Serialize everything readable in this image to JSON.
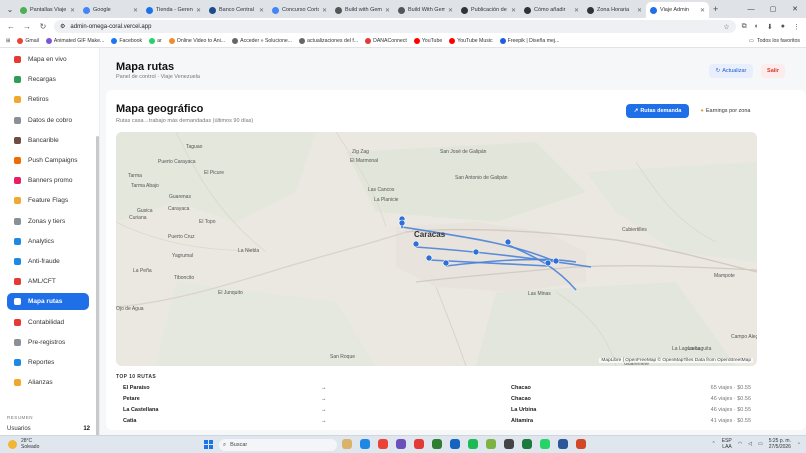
{
  "browser": {
    "tabs": [
      {
        "label": "Pantallas Viaje",
        "color": "#4caf50",
        "active": false
      },
      {
        "label": "Google",
        "color": "#4285f4",
        "active": false
      },
      {
        "label": "Tienda - Gerencia",
        "color": "#1a73e8",
        "active": false
      },
      {
        "label": "Banco Central",
        "color": "#1c4b8c",
        "active": false
      },
      {
        "label": "Concurso Corto",
        "color": "#4285f4",
        "active": false
      },
      {
        "label": "Build with Gemini",
        "color": "#555555",
        "active": false
      },
      {
        "label": "Build With Gemini",
        "color": "#555555",
        "active": false
      },
      {
        "label": "Publicación de",
        "color": "#333333",
        "active": false
      },
      {
        "label": "Cómo añadir",
        "color": "#333333",
        "active": false
      },
      {
        "label": "Zona Horaria",
        "color": "#333333",
        "active": false
      },
      {
        "label": "Viaje Admin",
        "color": "#1f6fe8",
        "active": true
      }
    ],
    "url": "admin-omega-coral.vercel.app",
    "bookmarks": [
      {
        "label": "Gmail",
        "color": "#ea4335"
      },
      {
        "label": "Animated GIF Make...",
        "color": "#7b57d6"
      },
      {
        "label": "Facebook",
        "color": "#1877f2"
      },
      {
        "label": "ar",
        "color": "#25d366"
      },
      {
        "label": "Online Video to Ani...",
        "color": "#f28b30"
      },
      {
        "label": "Acceder » Solucione...",
        "color": "#666666"
      },
      {
        "label": "actualizaciones del f...",
        "color": "#666666"
      },
      {
        "label": "DANAConnect",
        "color": "#e53935"
      },
      {
        "label": "YouTube",
        "color": "#ff0000"
      },
      {
        "label": "YouTube Music",
        "color": "#ff0000"
      },
      {
        "label": "Freepik | Diseña mej...",
        "color": "#1e5be6"
      }
    ],
    "all_bookmarks": "Todos los favoritos"
  },
  "sidebar": {
    "items": [
      {
        "label": "Mapa en vivo",
        "color": "#e53935"
      },
      {
        "label": "Recargas",
        "color": "#2e9e56"
      },
      {
        "label": "Retiros",
        "color": "#f0a830"
      },
      {
        "label": "Datos de cobro",
        "color": "#8a8f98"
      },
      {
        "label": "Bancarible",
        "color": "#6d4c41"
      },
      {
        "label": "Push Campaigns",
        "color": "#ef6c00"
      },
      {
        "label": "Banners promo",
        "color": "#e91e63"
      },
      {
        "label": "Feature Flags",
        "color": "#f0a830"
      },
      {
        "label": "Zonas y tiers",
        "color": "#8a8f98"
      },
      {
        "label": "Analytics",
        "color": "#1e88e5"
      },
      {
        "label": "Anti-fraude",
        "color": "#1e88e5"
      },
      {
        "label": "AML/CFT",
        "color": "#e53935"
      },
      {
        "label": "Mapa rutas",
        "color": "#ffffff",
        "active": true
      },
      {
        "label": "Contabilidad",
        "color": "#e53935"
      },
      {
        "label": "Pre-registros",
        "color": "#8a8f98"
      },
      {
        "label": "Reportes",
        "color": "#1e88e5"
      },
      {
        "label": "Alianzas",
        "color": "#f0a830"
      }
    ],
    "summary_title": "RESUMEN",
    "users_label": "Usuarios",
    "users_count": "12"
  },
  "header": {
    "title": "Mapa rutas",
    "subtitle": "Panel de control · Viaje Venezuela",
    "refresh_label": "Actualizar",
    "logout_label": "Salir"
  },
  "map_card": {
    "title": "Mapa geográfico",
    "subtitle": "Rutas casa→trabajo más demandadas (últimos 90 días)",
    "tab_routes": "Rutas demanda",
    "tab_earnings": "Earnings por zona",
    "attribution": "MapLibre | OpenFreeMap © OpenMapTiles Data from OpenStreetMap",
    "places": [
      "Taguao",
      "Puerto Carayaca",
      "Tarma",
      "Tarma Abajo",
      "Carayaca",
      "Guarenas",
      "Gusica",
      "Curiana",
      "El Topo",
      "La Niebla",
      "Yagrumal",
      "Tiboncito",
      "El Junquito",
      "La Peña",
      "Ojo de Agua",
      "Zig Zag",
      "El Marmonal",
      "San José de Galipán",
      "Las Cancos",
      "San Antonio de Galipán",
      "La Planicie",
      "Caracas",
      "Cubiertilles",
      "Mampote",
      "Campo Alegre",
      "La Laguita",
      "La Laguneta",
      "San Roque",
      "Las Minas",
      "Guaremete",
      "El Picure",
      "Puerto Cruz"
    ]
  },
  "top_routes": {
    "title": "TOP 10 RUTAS",
    "rows": [
      {
        "from": "El Paraíso",
        "sep": "→",
        "to": "Chacao",
        "value": "65 viajes · $0.55"
      },
      {
        "from": "Petare",
        "sep": "→",
        "to": "Chacao",
        "value": "46 viajes · $0.56"
      },
      {
        "from": "La Castellana",
        "sep": "→",
        "to": "La Urbina",
        "value": "46 viajes · $0.55"
      },
      {
        "from": "Catia",
        "sep": "→",
        "to": "Altamira",
        "value": "41 viajes · $0.55"
      }
    ]
  },
  "taskbar": {
    "temp": "28°C",
    "weather": "Soleado",
    "search": "Buscar",
    "lang": "ESP",
    "lang2": "LAA",
    "time": "5:25 p. m.",
    "date": "27/5/2026"
  }
}
